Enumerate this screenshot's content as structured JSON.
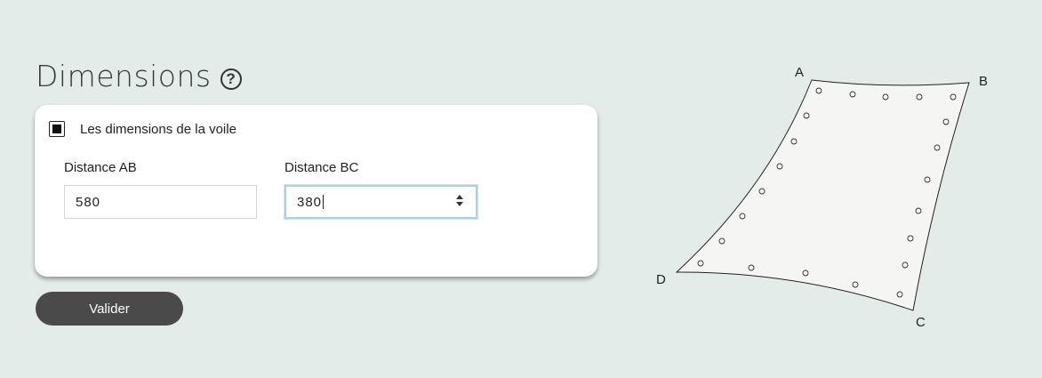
{
  "header": {
    "title": "Dimensions",
    "help_glyph": "?"
  },
  "card": {
    "checkbox_label": "Les dimensions de la voile",
    "fields": [
      {
        "label": "Distance AB",
        "value": "580"
      },
      {
        "label": "Distance BC",
        "value": "380"
      }
    ]
  },
  "submit_label": "Valider",
  "diagram": {
    "corners": [
      "A",
      "B",
      "C",
      "D"
    ]
  },
  "colors": {
    "background": "#e3ece9",
    "button": "#4a4a4a",
    "focus_border": "#a9d4e0"
  }
}
